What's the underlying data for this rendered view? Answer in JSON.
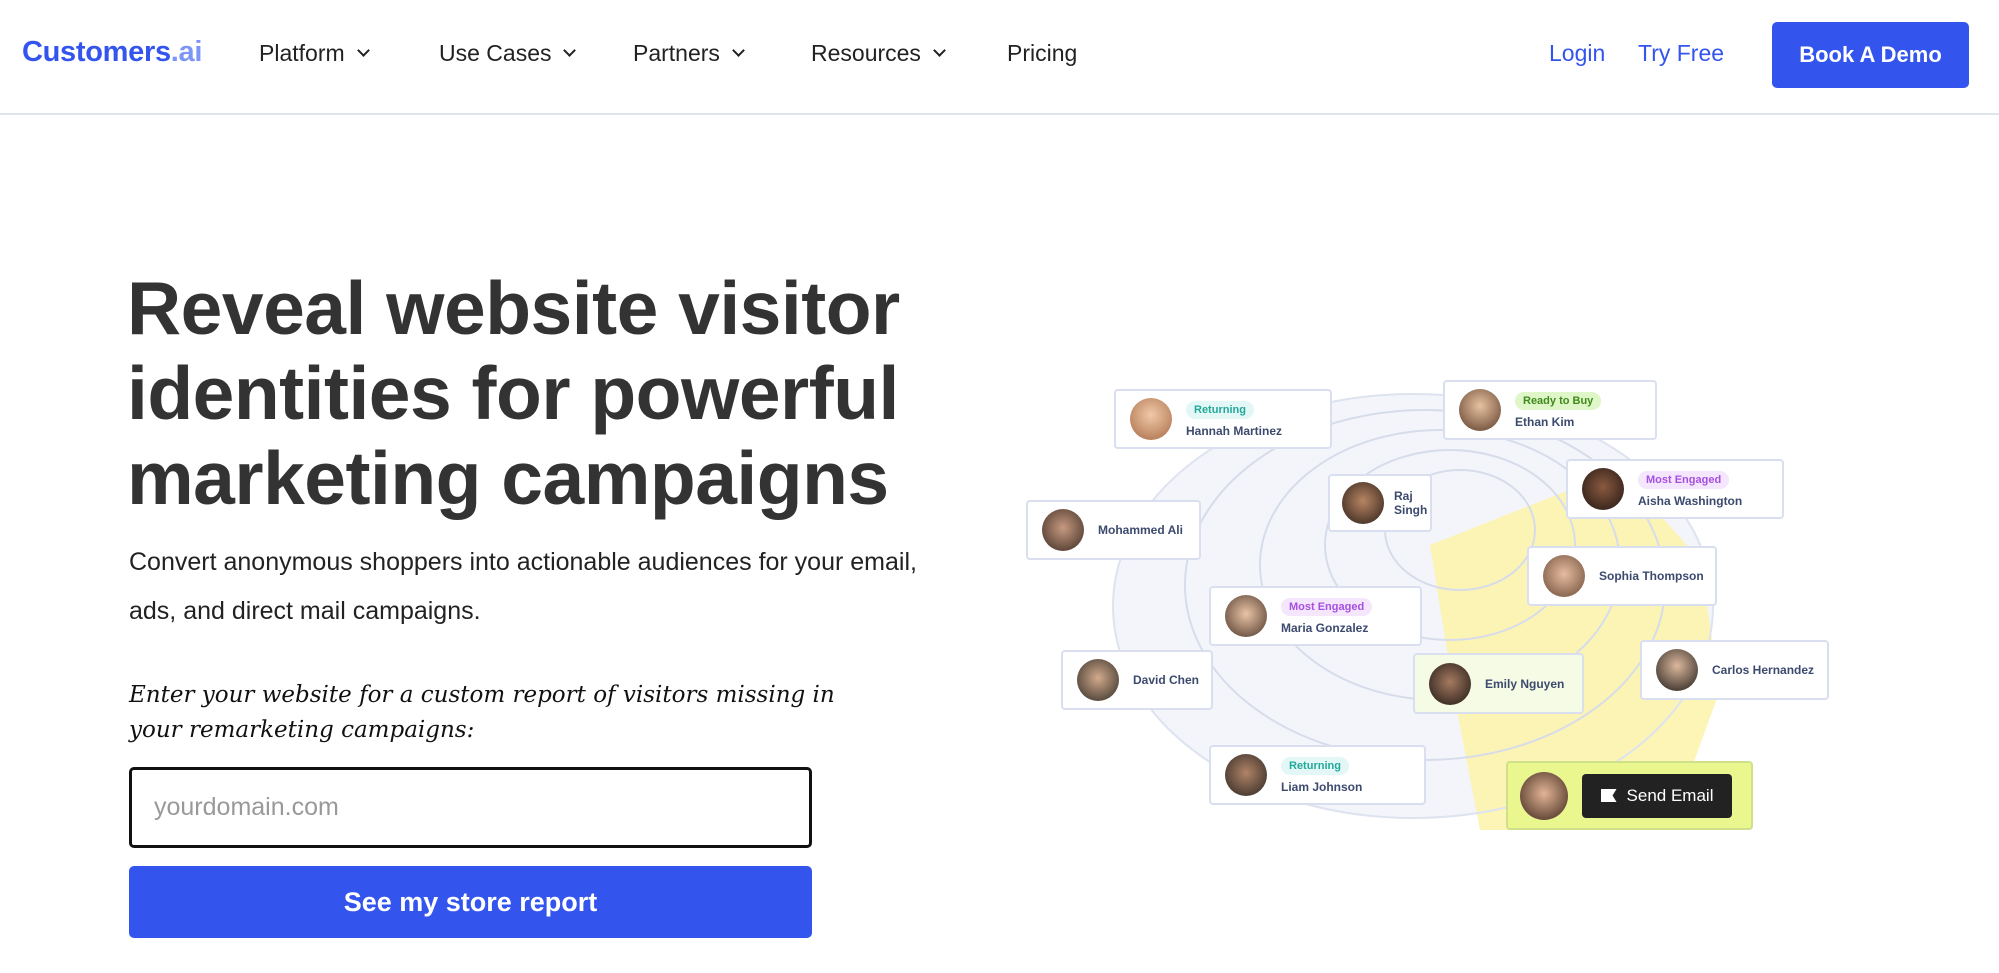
{
  "header": {
    "logo": {
      "main": "Customers",
      "suffix": ".ai"
    },
    "nav": [
      {
        "label": "Platform",
        "dropdown": true
      },
      {
        "label": "Use Cases",
        "dropdown": true
      },
      {
        "label": "Partners",
        "dropdown": true
      },
      {
        "label": "Resources",
        "dropdown": true
      },
      {
        "label": "Pricing",
        "dropdown": false
      }
    ],
    "login": "Login",
    "try_free": "Try Free",
    "book_demo": "Book A Demo"
  },
  "hero": {
    "title": "Reveal website visitor identities for powerful marketing campaigns",
    "subtitle": "Convert anonymous shoppers into actionable audiences for your email, ads, and direct mail campaigns.",
    "prompt": "Enter your website for a custom report of visitors missing in your remarketing campaigns:",
    "input_placeholder": "yourdomain.com",
    "cta": "See my store report"
  },
  "illustration": {
    "cards": [
      {
        "name": "Hannah Martinez",
        "badge": "Returning"
      },
      {
        "name": "Ethan Kim",
        "badge": "Ready to Buy"
      },
      {
        "name": "Raj Singh",
        "badge": ""
      },
      {
        "name": "Aisha Washington",
        "badge": "Most Engaged"
      },
      {
        "name": "Mohammed Ali",
        "badge": ""
      },
      {
        "name": "Sophia Thompson",
        "badge": ""
      },
      {
        "name": "Maria Gonzalez",
        "badge": "Most Engaged"
      },
      {
        "name": "David Chen",
        "badge": ""
      },
      {
        "name": "Emily Nguyen",
        "badge": ""
      },
      {
        "name": "Carlos Hernandez",
        "badge": ""
      },
      {
        "name": "Liam Johnson",
        "badge": "Returning"
      }
    ],
    "send_email": "Send Email"
  },
  "colors": {
    "brand": "#3355ee",
    "highlight": "#eaf78f"
  }
}
